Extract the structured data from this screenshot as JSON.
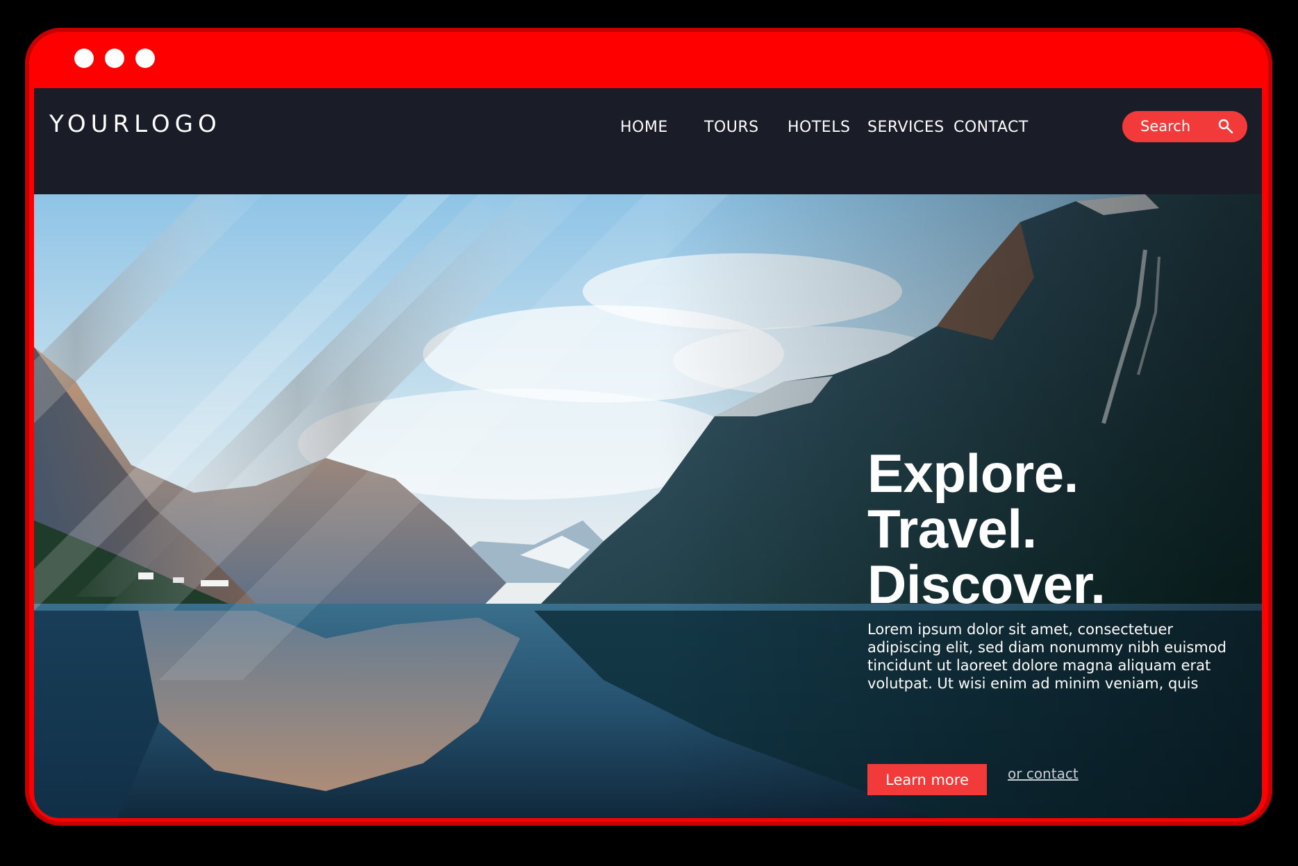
{
  "window": {
    "frame_color": "#ff0000",
    "controls": [
      "dot",
      "dot",
      "dot"
    ]
  },
  "header": {
    "logo": "YOURLOGO",
    "nav": [
      "HOME",
      "TOURS",
      "HOTELS",
      "SERVICES",
      "CONTACT"
    ],
    "search": {
      "label": "Search",
      "icon": "search-icon",
      "color": "#f23a3a"
    },
    "background": "#1a1d27"
  },
  "hero": {
    "headline": [
      "Explore.",
      "Travel.",
      "Discover."
    ],
    "body": "Lorem ipsum dolor sit amet, consectetuer adipiscing elit, sed diam nonummy nibh euismod tincidunt ut laoreet dolore magna aliquam erat volutpat. Ut wisi enim ad minim veniam, quis",
    "cta_label": "Learn more",
    "secondary_link": "or contact",
    "accent": "#f23a3a"
  }
}
